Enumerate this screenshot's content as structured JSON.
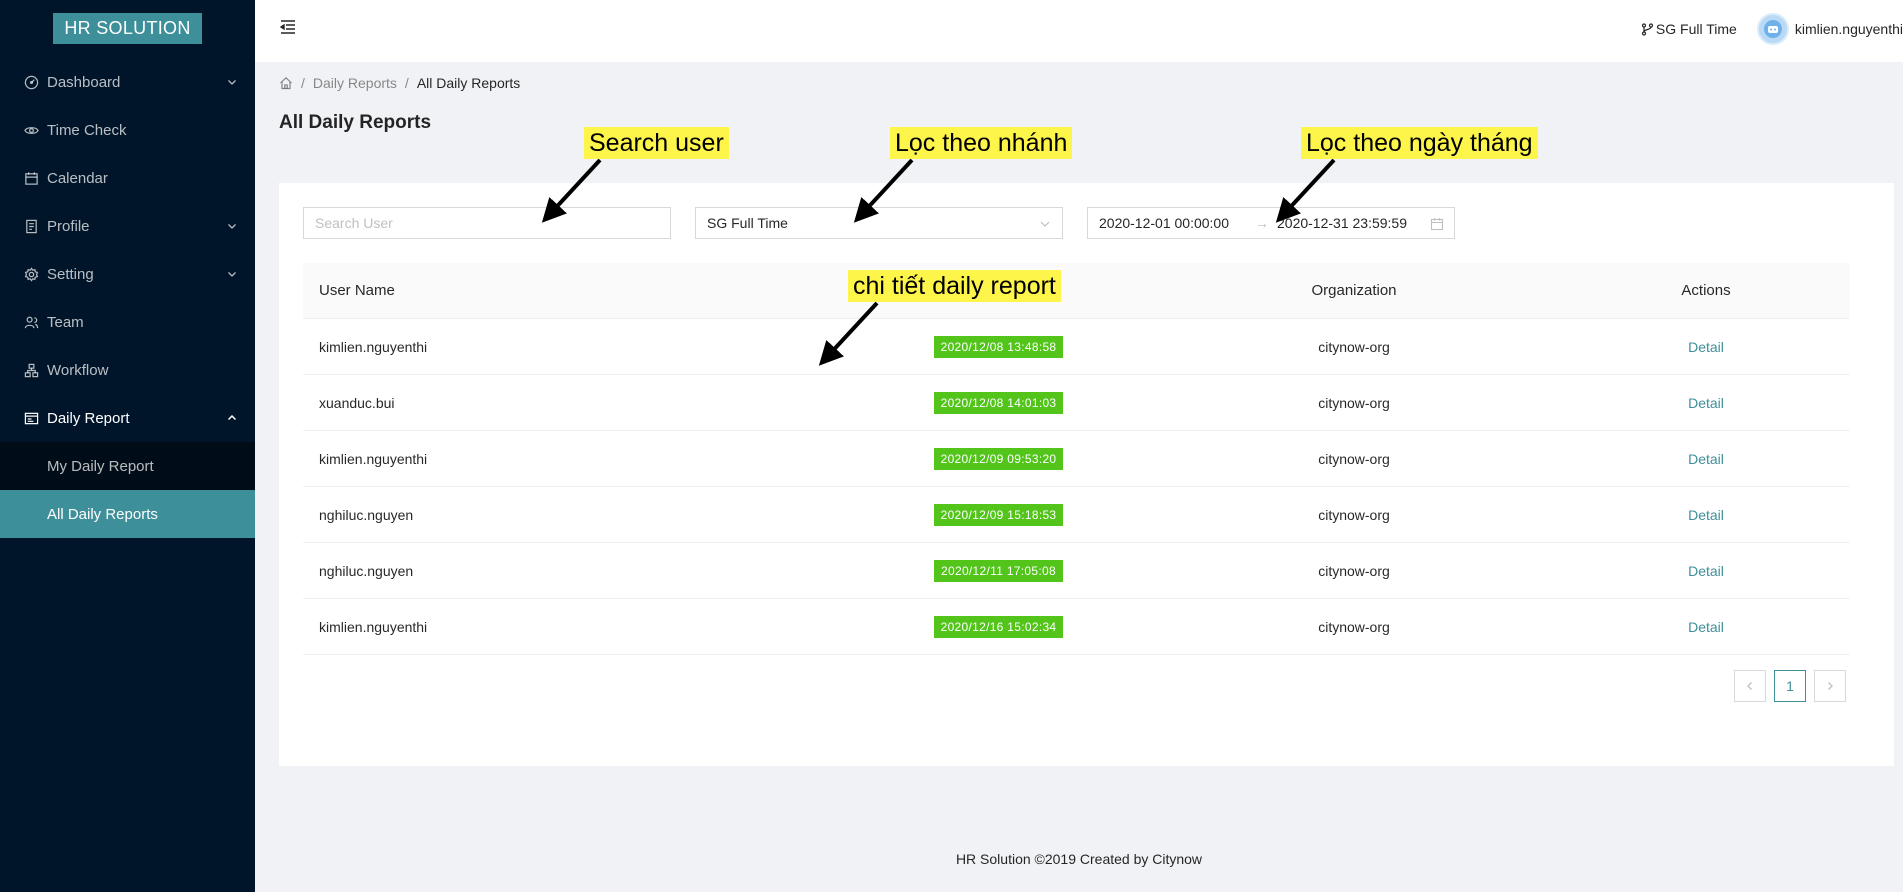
{
  "app": {
    "logo": "HR SOLUTION"
  },
  "sidebar": {
    "items": [
      {
        "label": "Dashboard",
        "icon": "dashboard-icon",
        "has_children": true
      },
      {
        "label": "Time Check",
        "icon": "eye-icon",
        "has_children": false
      },
      {
        "label": "Calendar",
        "icon": "calendar-icon",
        "has_children": false
      },
      {
        "label": "Profile",
        "icon": "profile-icon",
        "has_children": true
      },
      {
        "label": "Setting",
        "icon": "gear-icon",
        "has_children": true
      },
      {
        "label": "Team",
        "icon": "team-icon",
        "has_children": false
      },
      {
        "label": "Workflow",
        "icon": "workflow-icon",
        "has_children": false
      },
      {
        "label": "Daily Report",
        "icon": "report-icon",
        "has_children": true,
        "open": true
      }
    ],
    "submenu": [
      {
        "label": "My Daily Report",
        "active": false
      },
      {
        "label": "All Daily Reports",
        "active": true
      }
    ]
  },
  "header": {
    "branch": "SG Full Time",
    "user": "kimlien.nguyenthi"
  },
  "breadcrumb": {
    "items": [
      "Daily Reports",
      "All Daily Reports"
    ]
  },
  "page": {
    "title": "All Daily Reports"
  },
  "filters": {
    "search_placeholder": "Search User",
    "branch_value": "SG Full Time",
    "date_start": "2020-12-01 00:00:00",
    "date_end": "2020-12-31 23:59:59"
  },
  "table": {
    "columns": [
      "User Name",
      "",
      "Organization",
      "Actions"
    ],
    "rows": [
      {
        "user": "kimlien.nguyenthi",
        "time": "2020/12/08 13:48:58",
        "org": "citynow-org",
        "action": "Detail"
      },
      {
        "user": "xuanduc.bui",
        "time": "2020/12/08 14:01:03",
        "org": "citynow-org",
        "action": "Detail"
      },
      {
        "user": "kimlien.nguyenthi",
        "time": "2020/12/09 09:53:20",
        "org": "citynow-org",
        "action": "Detail"
      },
      {
        "user": "nghiluc.nguyen",
        "time": "2020/12/09 15:18:53",
        "org": "citynow-org",
        "action": "Detail"
      },
      {
        "user": "nghiluc.nguyen",
        "time": "2020/12/11 17:05:08",
        "org": "citynow-org",
        "action": "Detail"
      },
      {
        "user": "kimlien.nguyenthi",
        "time": "2020/12/16 15:02:34",
        "org": "citynow-org",
        "action": "Detail"
      }
    ]
  },
  "pagination": {
    "current": "1"
  },
  "footer": {
    "text": "HR Solution ©2019 Created by Citynow"
  },
  "annotations": {
    "search": "Search user",
    "branch": "Lọc theo nhánh",
    "date": "Lọc theo ngày tháng",
    "detail": "chi tiết daily report"
  },
  "colors": {
    "sidebar": "#001529",
    "accent": "#3d8f99",
    "tag": "#52c41a",
    "highlight": "#fdf54a"
  }
}
